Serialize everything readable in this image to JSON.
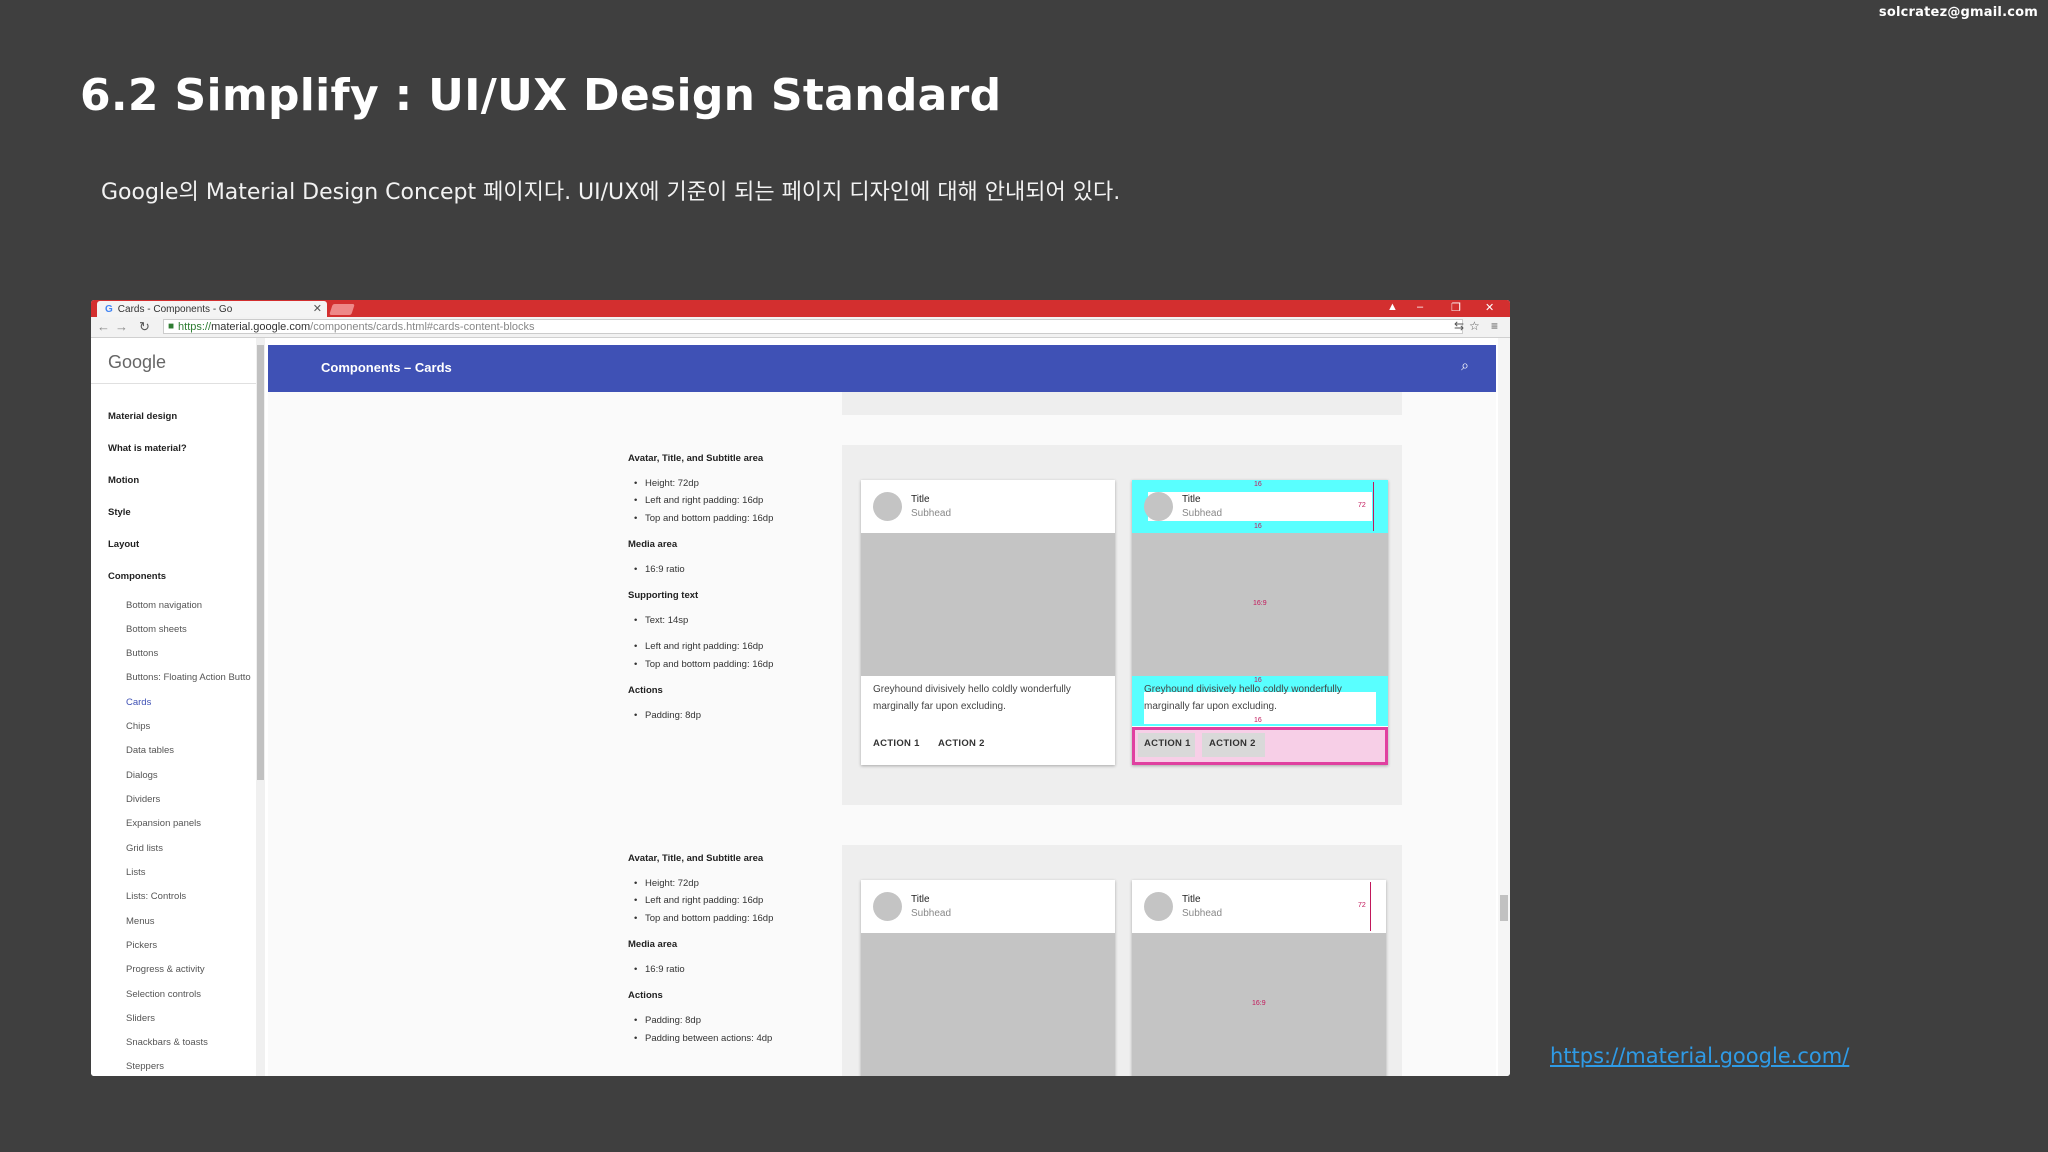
{
  "slide": {
    "email": "solcratez@gmail.com",
    "title": "6.2 Simplify : UI/UX Design Standard",
    "description": "Google의 Material Design Concept 페이지다. UI/UX에 기준이 되는 페이지 디자인에 대해 안내되어 있다.",
    "link": "https://material.google.com/"
  },
  "browser": {
    "tab_title": "Cards - Components - Go",
    "url_scheme": "https://",
    "url_domain": "material.google.com",
    "url_path": "/components/cards.html#cards-content-blocks",
    "window_min": "–",
    "window_max": "❐",
    "window_close": "✕"
  },
  "sidebar": {
    "logo": "Google",
    "items": [
      "Material design",
      "What is material?",
      "Motion",
      "Style",
      "Layout",
      "Components"
    ],
    "sub_items": [
      "Bottom navigation",
      "Bottom sheets",
      "Buttons",
      "Buttons: Floating Action Butto",
      "Cards",
      "Chips",
      "Data tables",
      "Dialogs",
      "Dividers",
      "Expansion panels",
      "Grid lists",
      "Lists",
      "Lists: Controls",
      "Menus",
      "Pickers",
      "Progress & activity",
      "Selection controls",
      "Sliders",
      "Snackbars & toasts",
      "Steppers"
    ],
    "active": "Cards"
  },
  "appbar": {
    "breadcrumb": "Components  –  Cards"
  },
  "spec1": {
    "h_avatar": "Avatar, Title, and Subtitle area",
    "height": "Height: 72dp",
    "lr_padding": "Left and right padding: 16dp",
    "tb_padding": "Top and bottom padding: 16dp",
    "h_media": "Media area",
    "ratio": "16:9 ratio",
    "h_support": "Supporting text",
    "text_size": "Text: 14sp",
    "lr_padding2": "Left and right padding: 16dp",
    "tb_padding2": "Top and bottom padding: 16dp",
    "h_actions": "Actions",
    "actions_padding": "Padding: 8dp"
  },
  "spec2": {
    "h_avatar": "Avatar, Title, and Subtitle area",
    "height": "Height: 72dp",
    "lr_padding": "Left and right padding: 16dp",
    "tb_padding": "Top and bottom padding: 16dp",
    "h_media": "Media area",
    "ratio": "16:9 ratio",
    "h_actions": "Actions",
    "actions_padding": "Padding: 8dp",
    "cutoff": "Padding between actions: 4dp"
  },
  "card": {
    "title": "Title",
    "subhead": "Subhead",
    "text": "Greyhound divisively hello coldly wonderfully marginally far upon excluding.",
    "action1": "ACTION 1",
    "action2": "ACTION 2"
  },
  "annotations": {
    "d16": "16",
    "d72": "72",
    "ratio": "16:9"
  }
}
